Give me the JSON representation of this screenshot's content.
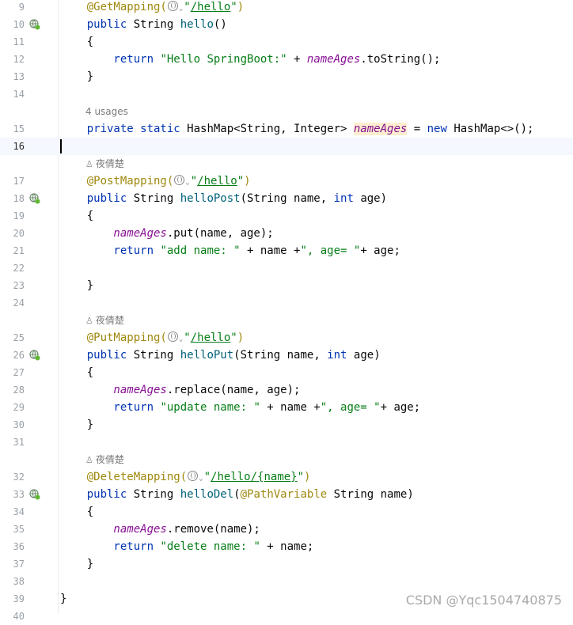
{
  "editor": {
    "lines": [
      {
        "n": "9",
        "gutter": "",
        "tokens": [
          [
            "ann",
            "    @GetMapping("
          ],
          [
            "globe",
            ""
          ],
          [
            "chev",
            "⌄"
          ],
          [
            "str",
            "\""
          ],
          [
            "url",
            "/hello"
          ],
          [
            "str",
            "\""
          ],
          [
            "ann",
            ")"
          ]
        ]
      },
      {
        "n": "10",
        "gutter": "endpoint",
        "tokens": [
          [
            "kw",
            "    public "
          ],
          [
            "",
            "String "
          ],
          [
            "fn",
            "hello"
          ],
          [
            "",
            "()"
          ]
        ]
      },
      {
        "n": "11",
        "gutter": "",
        "tokens": [
          [
            "",
            "    {"
          ]
        ]
      },
      {
        "n": "12",
        "gutter": "",
        "tokens": [
          [
            "kw",
            "        return "
          ],
          [
            "str",
            "\"Hello SpringBoot:\""
          ],
          [
            "",
            " + "
          ],
          [
            "fld",
            "nameAges"
          ],
          [
            "",
            ".toString();"
          ]
        ]
      },
      {
        "n": "13",
        "gutter": "",
        "tokens": [
          [
            "",
            "    }"
          ]
        ]
      },
      {
        "n": "14",
        "gutter": "",
        "tokens": []
      },
      {
        "hint": "4 usages"
      },
      {
        "n": "15",
        "gutter": "",
        "tokens": [
          [
            "kw",
            "    private static "
          ],
          [
            "",
            "HashMap<String, Integer> "
          ],
          [
            "fld hl",
            "nameAges"
          ],
          [
            "",
            " = "
          ],
          [
            "kw",
            "new "
          ],
          [
            "",
            "HashMap<>();"
          ]
        ]
      },
      {
        "n": "16",
        "gutter": "",
        "current": true,
        "tokens": [
          [
            "caret",
            ""
          ]
        ]
      },
      {
        "hint": "夜倩楚",
        "person": true
      },
      {
        "n": "17",
        "gutter": "",
        "tokens": [
          [
            "ann",
            "    @PostMapping("
          ],
          [
            "globe",
            ""
          ],
          [
            "chev",
            "⌄"
          ],
          [
            "str",
            "\""
          ],
          [
            "url",
            "/hello"
          ],
          [
            "str",
            "\""
          ],
          [
            "ann",
            ")"
          ]
        ]
      },
      {
        "n": "18",
        "gutter": "endpoint",
        "tokens": [
          [
            "kw",
            "    public "
          ],
          [
            "",
            "String "
          ],
          [
            "fn",
            "helloPost"
          ],
          [
            "",
            "(String name, "
          ],
          [
            "kw",
            "int "
          ],
          [
            "",
            "age)"
          ]
        ]
      },
      {
        "n": "19",
        "gutter": "",
        "tokens": [
          [
            "",
            "    {"
          ]
        ]
      },
      {
        "n": "20",
        "gutter": "",
        "tokens": [
          [
            "fld",
            "        nameAges"
          ],
          [
            "",
            ".put(name, age);"
          ]
        ]
      },
      {
        "n": "21",
        "gutter": "",
        "tokens": [
          [
            "kw",
            "        return "
          ],
          [
            "str",
            "\"add name: \""
          ],
          [
            "",
            " + name +"
          ],
          [
            "str",
            "\", age= \""
          ],
          [
            "",
            "+ age;"
          ]
        ]
      },
      {
        "n": "22",
        "gutter": "",
        "tokens": []
      },
      {
        "n": "23",
        "gutter": "",
        "tokens": [
          [
            "",
            "    }"
          ]
        ]
      },
      {
        "n": "24",
        "gutter": "",
        "tokens": []
      },
      {
        "hint": "夜倩楚",
        "person": true
      },
      {
        "n": "25",
        "gutter": "",
        "tokens": [
          [
            "ann",
            "    @PutMapping("
          ],
          [
            "globe",
            ""
          ],
          [
            "chev",
            "⌄"
          ],
          [
            "str",
            "\""
          ],
          [
            "url",
            "/hello"
          ],
          [
            "str",
            "\""
          ],
          [
            "ann",
            ")"
          ]
        ]
      },
      {
        "n": "26",
        "gutter": "endpoint",
        "tokens": [
          [
            "kw",
            "    public "
          ],
          [
            "",
            "String "
          ],
          [
            "fn",
            "helloPut"
          ],
          [
            "",
            "(String name, "
          ],
          [
            "kw",
            "int "
          ],
          [
            "",
            "age)"
          ]
        ]
      },
      {
        "n": "27",
        "gutter": "",
        "tokens": [
          [
            "",
            "    {"
          ]
        ]
      },
      {
        "n": "28",
        "gutter": "",
        "tokens": [
          [
            "fld",
            "        nameAges"
          ],
          [
            "",
            ".replace(name, age);"
          ]
        ]
      },
      {
        "n": "29",
        "gutter": "",
        "tokens": [
          [
            "kw",
            "        return "
          ],
          [
            "str",
            "\"update name: \""
          ],
          [
            "",
            " + name +"
          ],
          [
            "str",
            "\", age= \""
          ],
          [
            "",
            "+ age;"
          ]
        ]
      },
      {
        "n": "30",
        "gutter": "",
        "tokens": [
          [
            "",
            "    }"
          ]
        ]
      },
      {
        "n": "31",
        "gutter": "",
        "tokens": []
      },
      {
        "hint": "夜倩楚",
        "person": true
      },
      {
        "n": "32",
        "gutter": "",
        "tokens": [
          [
            "ann",
            "    @DeleteMapping("
          ],
          [
            "globe",
            ""
          ],
          [
            "chev",
            "⌄"
          ],
          [
            "str",
            "\""
          ],
          [
            "url",
            "/hello/"
          ],
          [
            "url",
            "{name}"
          ],
          [
            "str",
            "\""
          ],
          [
            "ann",
            ")"
          ]
        ]
      },
      {
        "n": "33",
        "gutter": "endpoint",
        "tokens": [
          [
            "kw",
            "    public "
          ],
          [
            "",
            "String "
          ],
          [
            "fn",
            "helloDel"
          ],
          [
            "",
            "("
          ],
          [
            "ann",
            "@PathVariable "
          ],
          [
            "",
            "String name)"
          ]
        ]
      },
      {
        "n": "34",
        "gutter": "",
        "tokens": [
          [
            "",
            "    {"
          ]
        ]
      },
      {
        "n": "35",
        "gutter": "",
        "tokens": [
          [
            "fld",
            "        nameAges"
          ],
          [
            "",
            ".remove(name);"
          ]
        ]
      },
      {
        "n": "36",
        "gutter": "",
        "tokens": [
          [
            "kw",
            "        return "
          ],
          [
            "str",
            "\"delete name: \""
          ],
          [
            "",
            " + name;"
          ]
        ]
      },
      {
        "n": "37",
        "gutter": "",
        "tokens": [
          [
            "",
            "    }"
          ]
        ]
      },
      {
        "n": "38",
        "gutter": "",
        "tokens": []
      },
      {
        "n": "39",
        "gutter": "",
        "tokens": [
          [
            "",
            "}"
          ]
        ]
      },
      {
        "n": "40",
        "gutter": "",
        "tokens": []
      }
    ]
  },
  "watermark": "CSDN @Yqc1504740875",
  "icons": {
    "endpoint": "web-endpoint-icon",
    "user": "person-icon",
    "url": "globe-icon"
  },
  "colors": {
    "keyword": "#0033b3",
    "annotation": "#9e880d",
    "string": "#067d17",
    "field": "#871094",
    "method": "#00627a",
    "current_line": "#f5f8fe"
  }
}
